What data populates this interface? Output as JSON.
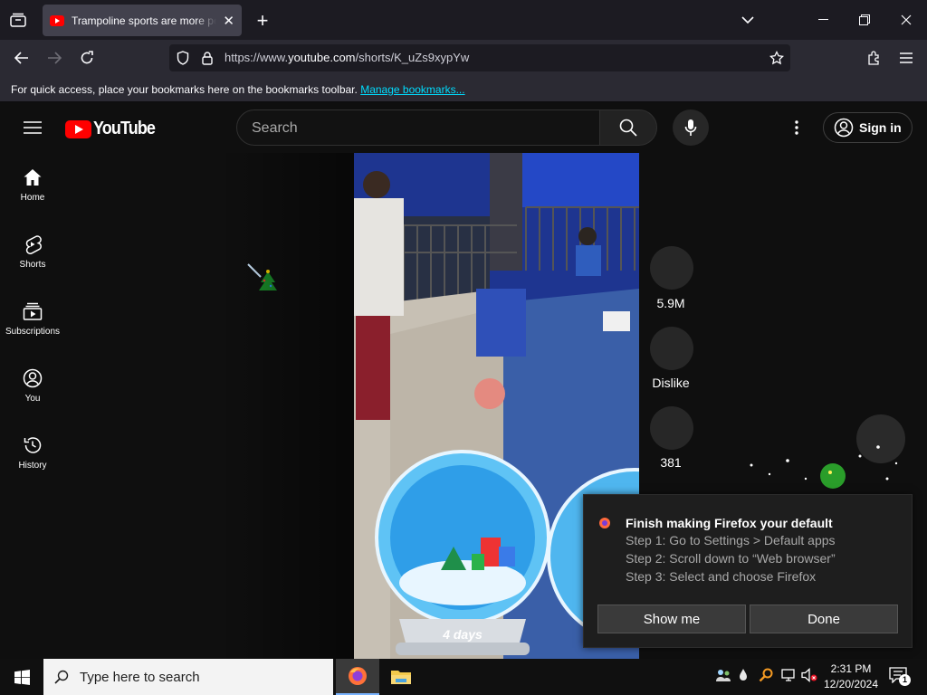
{
  "browser": {
    "tab_title": "Trampoline sports are more po",
    "url_prefix": "https://www.",
    "url_host": "youtube.com",
    "url_path": "/shorts/K_uZs9xypYw",
    "bookmarks_text": "For quick access, place your bookmarks here on the bookmarks toolbar.",
    "manage_bookmarks": "Manage bookmarks..."
  },
  "youtube": {
    "logo_text": "YouTube",
    "search_placeholder": "Search",
    "signin_label": "Sign in",
    "sidebar": [
      {
        "label": "Home",
        "icon": "home-icon"
      },
      {
        "label": "Shorts",
        "icon": "shorts-icon"
      },
      {
        "label": "Subscriptions",
        "icon": "subscriptions-icon"
      },
      {
        "label": "You",
        "icon": "you-icon"
      },
      {
        "label": "History",
        "icon": "history-icon"
      }
    ],
    "actions": {
      "likes": "5.9M",
      "dislike": "Dislike",
      "comments": "381"
    },
    "video_overlay_text": "4 days"
  },
  "notification": {
    "title": "Finish making Firefox your default",
    "steps": [
      "Step 1: Go to Settings > Default apps",
      "Step 2: Scroll down to “Web browser”",
      "Step 3: Select and choose Firefox"
    ],
    "show_me": "Show me",
    "done": "Done"
  },
  "taskbar": {
    "search_placeholder": "Type here to search",
    "time": "2:31 PM",
    "date": "12/20/2024",
    "notification_count": "1"
  },
  "colors": {
    "youtube_red": "#ff0000",
    "link": "#00ddff"
  }
}
